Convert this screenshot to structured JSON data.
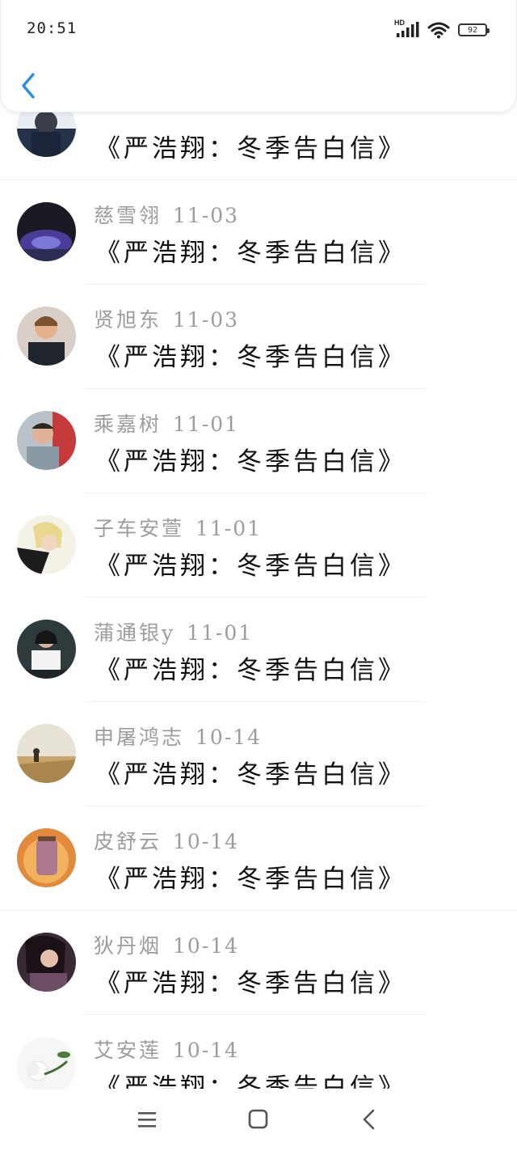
{
  "status_bar": {
    "time": "20:51",
    "network_label": "HD",
    "battery_level": "92",
    "icons": [
      "signal-icon",
      "wifi-icon",
      "battery-icon"
    ]
  },
  "header": {
    "back_icon": "chevron-left-icon",
    "accent_color": "#2b8de8"
  },
  "comments": [
    {
      "name": "",
      "date": "",
      "text": "《严浩翔：冬季告白信》"
    },
    {
      "name": "慈雪翎",
      "date": "11-03",
      "text": "《严浩翔：冬季告白信》"
    },
    {
      "name": "贤旭东",
      "date": "11-03",
      "text": "《严浩翔：冬季告白信》"
    },
    {
      "name": "乘嘉树",
      "date": "11-01",
      "text": "《严浩翔：冬季告白信》"
    },
    {
      "name": "子车安萱",
      "date": "11-01",
      "text": "《严浩翔：冬季告白信》"
    },
    {
      "name": "蒲通银y",
      "date": "11-01",
      "text": "《严浩翔：冬季告白信》"
    },
    {
      "name": "申屠鸿志",
      "date": "10-14",
      "text": "《严浩翔：冬季告白信》"
    },
    {
      "name": "皮舒云",
      "date": "10-14",
      "text": "《严浩翔：冬季告白信》"
    },
    {
      "name": "狄丹烟",
      "date": "10-14",
      "text": "《严浩翔：冬季告白信》"
    },
    {
      "name": "艾安莲",
      "date": "10-14",
      "text": "《严浩翔：冬季告白信》"
    }
  ],
  "bottom_nav": {
    "icons": [
      "menu-icon",
      "home-icon",
      "back-icon"
    ]
  }
}
